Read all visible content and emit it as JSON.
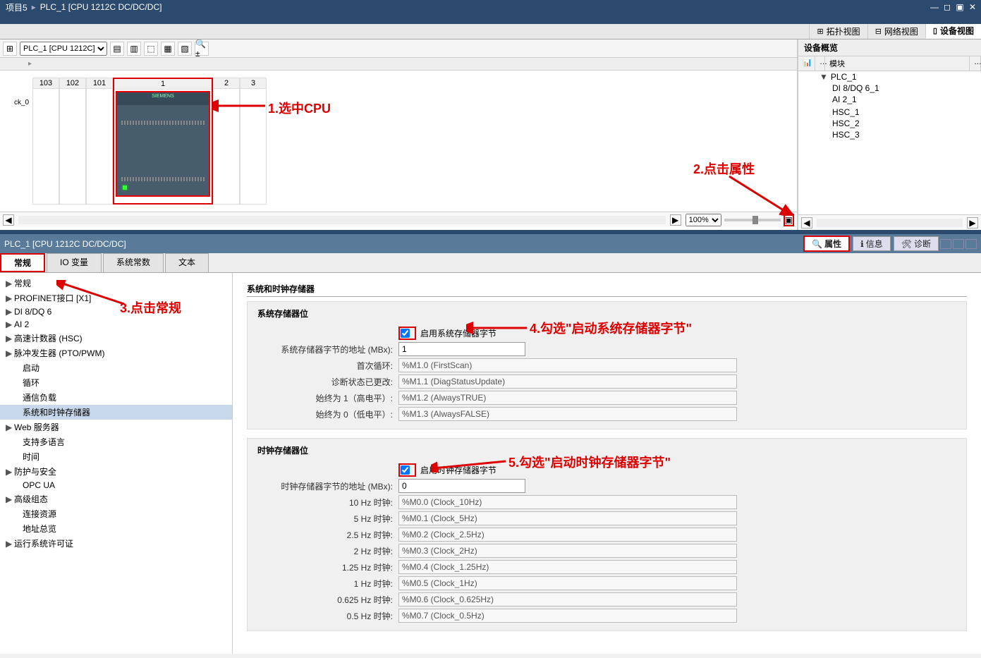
{
  "titlebar": {
    "project": "项目5",
    "device": "PLC_1 [CPU 1212C DC/DC/DC]"
  },
  "viewTabs": {
    "topology": "拓扑视图",
    "network": "网络视图",
    "device": "设备视图"
  },
  "deviceSelector": "PLC_1 [CPU 1212C]",
  "slots": {
    "s103": "103",
    "s102": "102",
    "s101": "101",
    "s1": "1",
    "s2": "2",
    "s3": "3"
  },
  "rackLabel": "ck_0",
  "cpuLabel": "SIEMENS",
  "zoom": "100%",
  "overview": {
    "title": "设备概览",
    "colModule": "模块",
    "items": [
      {
        "name": "PLC_1",
        "indent": 1,
        "expand": true
      },
      {
        "name": "DI 8/DQ 6_1",
        "indent": 2
      },
      {
        "name": "AI 2_1",
        "indent": 2
      },
      {
        "name": "",
        "indent": 2
      },
      {
        "name": "HSC_1",
        "indent": 2
      },
      {
        "name": "HSC_2",
        "indent": 2
      },
      {
        "name": "HSC_3",
        "indent": 2
      }
    ]
  },
  "annotations": {
    "a1": "1.选中CPU",
    "a2": "2.点击属性",
    "a3": "3.点击常规",
    "a4": "4.勾选\"启动系统存储器字节\"",
    "a5": "5.勾选\"启动时钟存储器字节\""
  },
  "propsHeader": {
    "title": "PLC_1 [CPU 1212C DC/DC/DC]",
    "tabProps": "属性",
    "tabInfo": "信息",
    "tabDiag": "诊断"
  },
  "propTabs": {
    "general": "常规",
    "iovar": "IO 变量",
    "sysconst": "系统常数",
    "text": "文本"
  },
  "navTree": [
    {
      "label": "常规",
      "caret": "▶"
    },
    {
      "label": "PROFINET接口 [X1]",
      "caret": "▶"
    },
    {
      "label": "DI 8/DQ 6",
      "caret": "▶"
    },
    {
      "label": "AI 2",
      "caret": "▶"
    },
    {
      "label": "高速计数器 (HSC)",
      "caret": "▶"
    },
    {
      "label": "脉冲发生器 (PTO/PWM)",
      "caret": "▶"
    },
    {
      "label": "启动",
      "caret": "",
      "indent": 1
    },
    {
      "label": "循环",
      "caret": "",
      "indent": 1
    },
    {
      "label": "通信负载",
      "caret": "",
      "indent": 1
    },
    {
      "label": "系统和时钟存储器",
      "caret": "",
      "indent": 1,
      "selected": true
    },
    {
      "label": "Web 服务器",
      "caret": "▶"
    },
    {
      "label": "支持多语言",
      "caret": "",
      "indent": 1
    },
    {
      "label": "时间",
      "caret": "",
      "indent": 1
    },
    {
      "label": "防护与安全",
      "caret": "▶"
    },
    {
      "label": "OPC UA",
      "caret": "",
      "indent": 1
    },
    {
      "label": "高级组态",
      "caret": "▶"
    },
    {
      "label": "连接资源",
      "caret": "",
      "indent": 1
    },
    {
      "label": "地址总览",
      "caret": "",
      "indent": 1
    },
    {
      "label": "运行系统许可证",
      "caret": "▶"
    }
  ],
  "content": {
    "mainTitle": "系统和时钟存储器",
    "sysGroup": {
      "title": "系统存储器位",
      "enableLabel": "启用系统存储器字节",
      "addrLabel": "系统存储器字节的地址 (MBx):",
      "addrValue": "1",
      "firstScanLabel": "首次循环:",
      "firstScanValue": "%M1.0 (FirstScan)",
      "diagLabel": "诊断状态已更改:",
      "diagValue": "%M1.1 (DiagStatusUpdate)",
      "alwaysTrueLabel": "始终为 1（高电平）:",
      "alwaysTrueValue": "%M1.2 (AlwaysTRUE)",
      "alwaysFalseLabel": "始终为 0（低电平）:",
      "alwaysFalseValue": "%M1.3 (AlwaysFALSE)"
    },
    "clkGroup": {
      "title": "时钟存储器位",
      "enableLabel": "启用时钟存储器字节",
      "addrLabel": "时钟存储器字节的地址 (MBx):",
      "addrValue": "0",
      "rows": [
        {
          "label": "10 Hz 时钟:",
          "value": "%M0.0 (Clock_10Hz)"
        },
        {
          "label": "5 Hz 时钟:",
          "value": "%M0.1 (Clock_5Hz)"
        },
        {
          "label": "2.5 Hz 时钟:",
          "value": "%M0.2 (Clock_2.5Hz)"
        },
        {
          "label": "2 Hz 时钟:",
          "value": "%M0.3 (Clock_2Hz)"
        },
        {
          "label": "1.25 Hz 时钟:",
          "value": "%M0.4 (Clock_1.25Hz)"
        },
        {
          "label": "1 Hz 时钟:",
          "value": "%M0.5 (Clock_1Hz)"
        },
        {
          "label": "0.625 Hz 时钟:",
          "value": "%M0.6 (Clock_0.625Hz)"
        },
        {
          "label": "0.5 Hz 时钟:",
          "value": "%M0.7 (Clock_0.5Hz)"
        }
      ]
    }
  }
}
